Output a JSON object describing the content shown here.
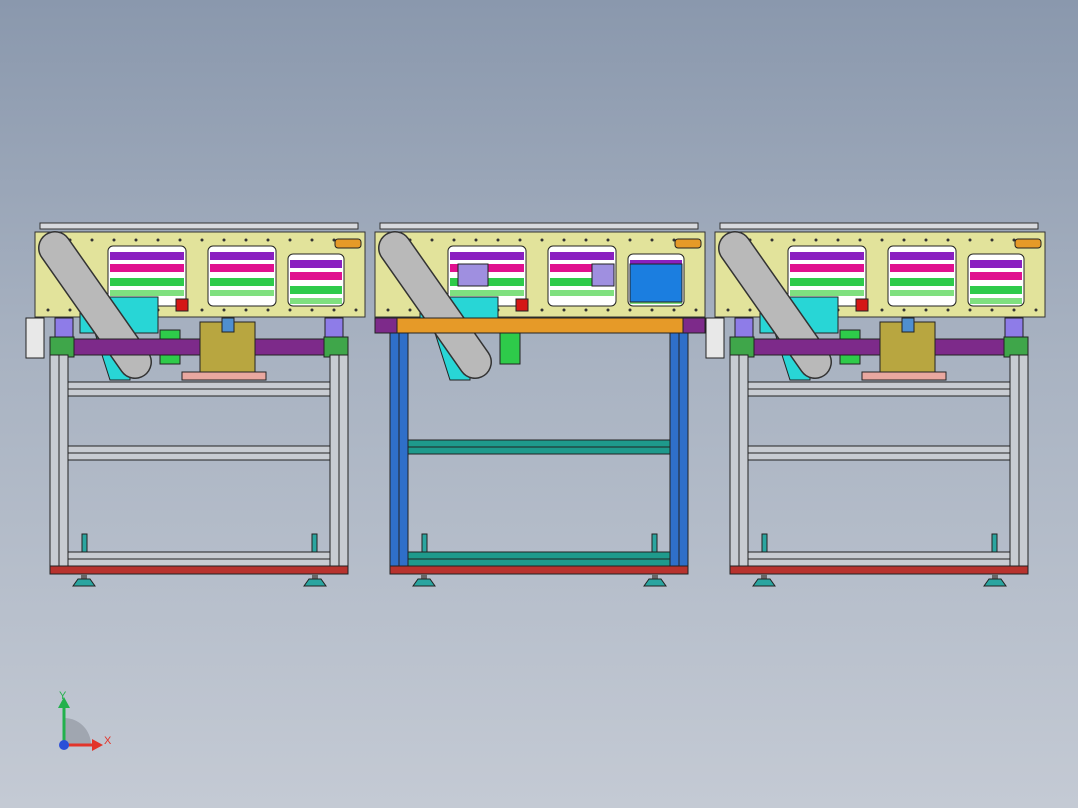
{
  "viewport": {
    "background_top": "#8a98ad",
    "background_bottom": "#c4cad4"
  },
  "colors": {
    "panel_yellow": "#e2e39b",
    "frame_grey": "#c8ccd2",
    "frame_dark": "#4a4e55",
    "blue_frame": "#2f6fc9",
    "teal_rail": "#1e9a8c",
    "magenta": "#e0118f",
    "purple": "#8a1fc0",
    "green": "#2ecb4a",
    "cyan": "#28d6d6",
    "belt_grey": "#b9b9b9",
    "red_sensor": "#d41616",
    "orange_beam": "#e69a28",
    "blue_box": "#1b7ee0",
    "purple_beam": "#7d2a8a",
    "foot_red": "#b8332e",
    "foot_teal": "#2aa5a0"
  },
  "modules": [
    {
      "name": "module-left",
      "variant": "grey"
    },
    {
      "name": "module-center",
      "variant": "blue"
    },
    {
      "name": "module-right",
      "variant": "grey"
    }
  ],
  "triad": {
    "x_label": "X",
    "y_label": "Y",
    "x_color": "#e2342a",
    "y_color": "#22b14c",
    "z_color": "#2b4fd8"
  }
}
